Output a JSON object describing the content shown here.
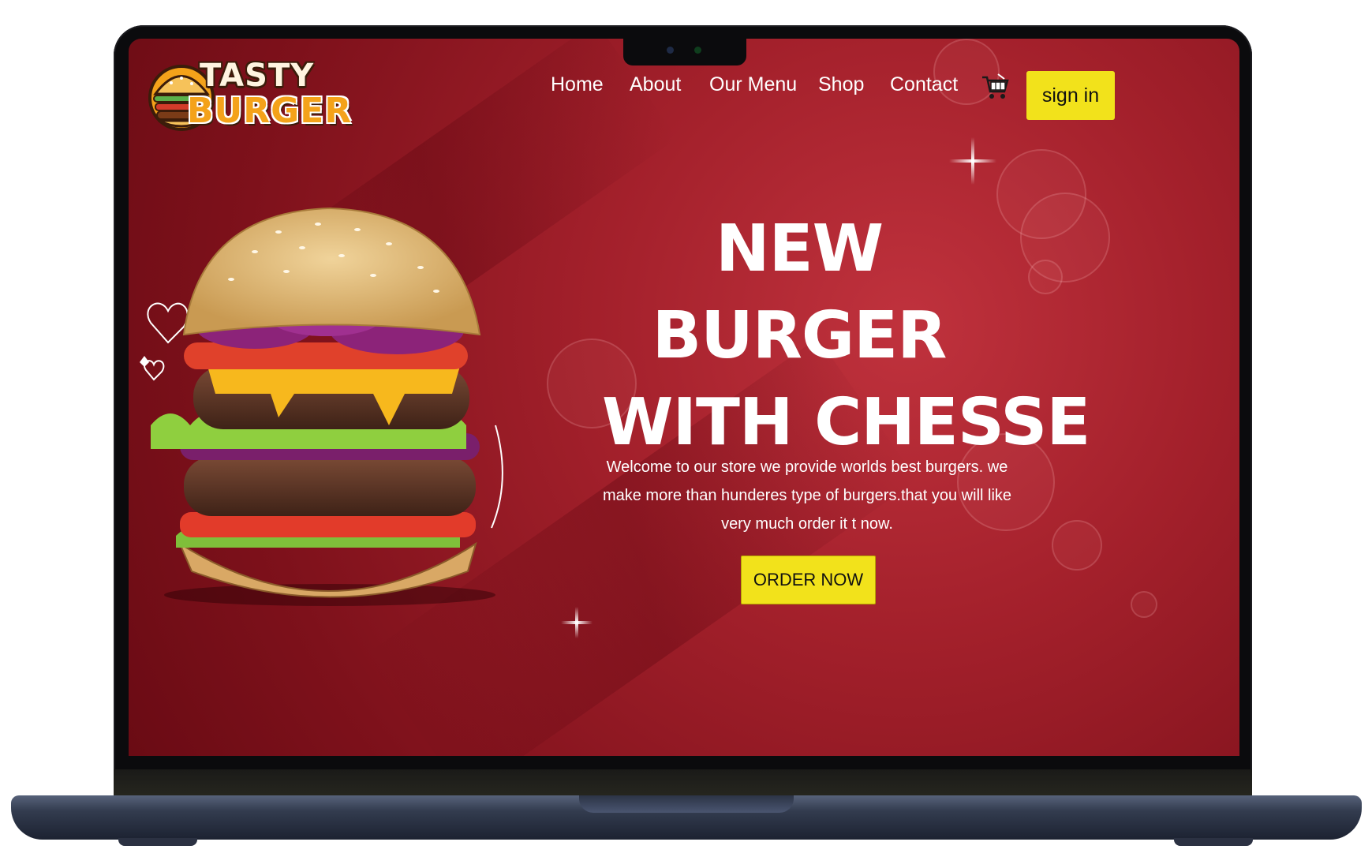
{
  "brand": {
    "logo_line1": "TASTY",
    "logo_line2": "BURGER"
  },
  "nav": {
    "items": [
      {
        "label": "Home"
      },
      {
        "label": "About"
      },
      {
        "label": "Our Menu"
      },
      {
        "label": "Shop"
      },
      {
        "label": "Contact"
      }
    ],
    "cart_icon": "shopping-cart-icon",
    "signin_label": "sign in"
  },
  "hero": {
    "title_lines": [
      "NEW",
      "BURGER",
      "WITH CHESSE"
    ],
    "description": "Welcome to our store we provide worlds best burgers. we make more than hunderes type of burgers.that you will like very much order it t now.",
    "cta_label": "ORDER NOW"
  },
  "colors": {
    "background": "#a3202b",
    "button": "#f2e21b",
    "text": "#ffffff",
    "logo_orange": "#f4a21a"
  }
}
